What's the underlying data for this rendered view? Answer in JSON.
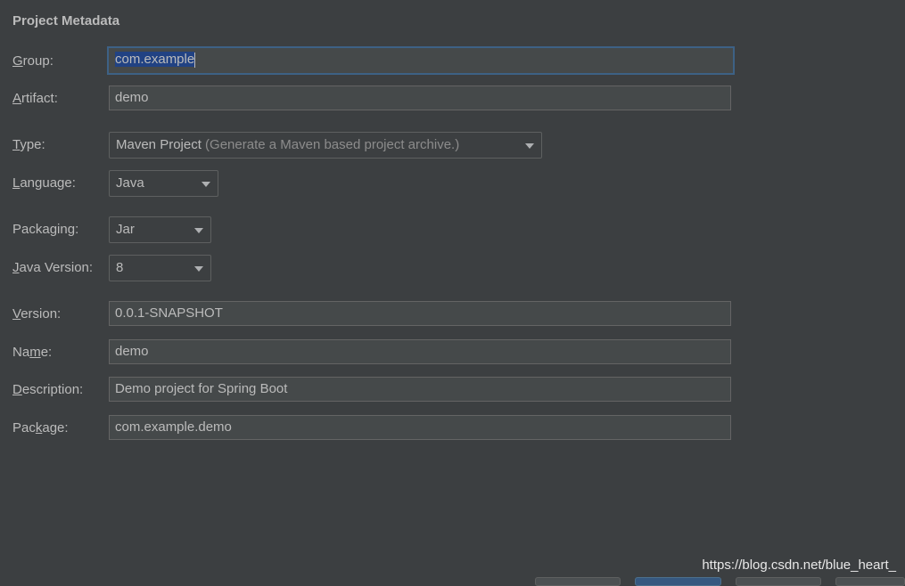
{
  "title": "Project Metadata",
  "fields": {
    "group": {
      "label_u": "G",
      "label_rest": "roup:",
      "value": "com.example"
    },
    "artifact": {
      "label_pre": "",
      "label_u": "A",
      "label_rest": "rtifact:",
      "value": "demo"
    },
    "version": {
      "label_u": "V",
      "label_rest": "ersion:",
      "value": "0.0.1-SNAPSHOT"
    },
    "name": {
      "label_pre": "Na",
      "label_u": "m",
      "label_rest": "e:",
      "value": "demo"
    },
    "description": {
      "label_u": "D",
      "label_rest": "escription:",
      "value": "Demo project for Spring Boot"
    },
    "package": {
      "label_pre": "Pac",
      "label_u": "k",
      "label_rest": "age:",
      "value": "com.example.demo"
    }
  },
  "combos": {
    "type": {
      "label_u": "T",
      "label_rest": "ype:",
      "value": "Maven Project",
      "hint": "(Generate a Maven based project archive.)"
    },
    "language": {
      "label_u": "L",
      "label_rest": "anguage:",
      "value": "Java"
    },
    "packaging": {
      "label_pre": "Packa",
      "label_u": "g",
      "label_rest": "ing:",
      "value": "Jar"
    },
    "java_version": {
      "label_u": "J",
      "label_rest": "ava Version:",
      "value": "8"
    }
  },
  "watermark": "https://blog.csdn.net/blue_heart_",
  "colors": {
    "background": "#3c3f41",
    "field_bg": "#45494a",
    "focus_border": "#3d6185",
    "selection": "#214283"
  }
}
